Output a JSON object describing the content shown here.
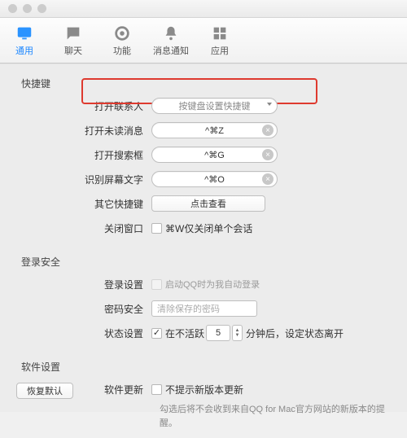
{
  "toolbar": {
    "items": [
      {
        "label": "通用",
        "icon": "display-icon",
        "active": true
      },
      {
        "label": "聊天",
        "icon": "chat-icon"
      },
      {
        "label": "功能",
        "icon": "gear-icon"
      },
      {
        "label": "消息通知",
        "icon": "bell-icon"
      },
      {
        "label": "应用",
        "icon": "apps-icon"
      }
    ]
  },
  "sections": {
    "shortcuts": {
      "title": "快捷键",
      "rows": {
        "open_contacts": {
          "label": "打开联系人",
          "value": "按键盘设置快捷键"
        },
        "open_unread": {
          "label": "打开未读消息",
          "value": "^⌘Z"
        },
        "open_search": {
          "label": "打开搜索框",
          "value": "^⌘G"
        },
        "ocr_screen": {
          "label": "识别屏幕文字",
          "value": "^⌘O"
        },
        "other": {
          "label": "其它快捷键",
          "button": "点击查看"
        },
        "close_win": {
          "label": "关闭窗口",
          "checkbox": "⌘W仅关闭单个会话",
          "checked": false
        }
      }
    },
    "login": {
      "title": "登录安全",
      "rows": {
        "login_set": {
          "label": "登录设置",
          "checkbox": "启动QQ时为我自动登录",
          "checked": false,
          "disabled": true
        },
        "pwd_safe": {
          "label": "密码安全",
          "placeholder": "清除保存的密码"
        },
        "status": {
          "label": "状态设置",
          "pre": "在不活跃",
          "value": "5",
          "post": "分钟后，设定状态离开",
          "checked": true
        }
      }
    },
    "software": {
      "title": "软件设置",
      "rows": {
        "update": {
          "label": "软件更新",
          "checkbox": "不提示新版本更新",
          "checked": false,
          "help": "勾选后将不会收到来自QQ for Mac官方网站的新版本的提醒。"
        }
      }
    }
  },
  "footer": {
    "restore": "恢复默认"
  }
}
